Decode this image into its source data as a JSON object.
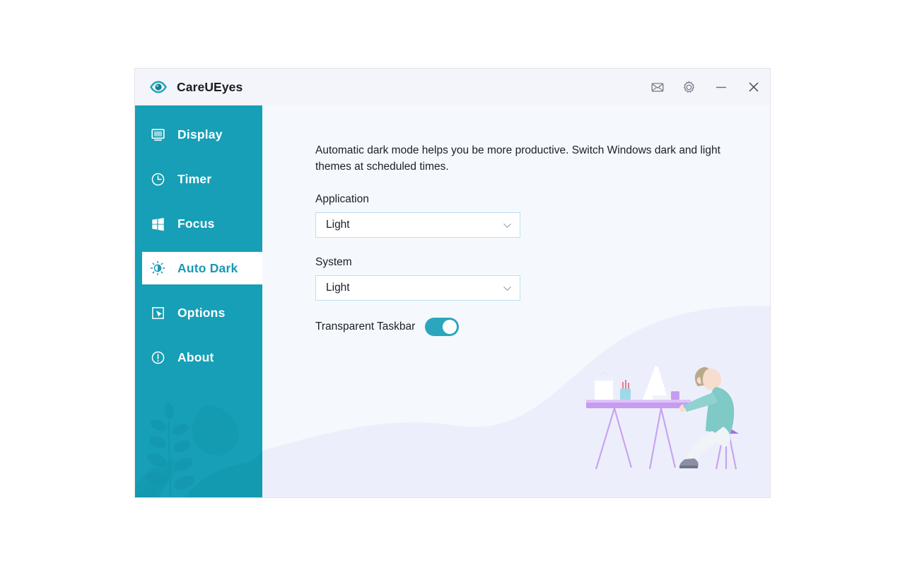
{
  "window": {
    "title": "CareUEyes",
    "logo_icon": "eye-icon",
    "titlebar_buttons": [
      {
        "name": "feedback-mail-button",
        "icon": "mail-envelope-icon",
        "label": ""
      },
      {
        "name": "settings-button",
        "icon": "gear-icon",
        "label": ""
      },
      {
        "name": "minimize-button",
        "icon": "minimize-icon",
        "label": ""
      },
      {
        "name": "close-button",
        "icon": "close-icon",
        "label": ""
      }
    ]
  },
  "sidebar": {
    "background_color": "#169fb6",
    "active_text_color": "#1899b4",
    "items": [
      {
        "id": "display",
        "label": "Display",
        "icon": "monitor-icon",
        "active": false
      },
      {
        "id": "timer",
        "label": "Timer",
        "icon": "clock-icon",
        "active": false
      },
      {
        "id": "focus",
        "label": "Focus",
        "icon": "windows-logo-icon",
        "active": false
      },
      {
        "id": "auto-dark",
        "label": "Auto Dark",
        "icon": "brightness-sun-icon",
        "active": true
      },
      {
        "id": "options",
        "label": "Options",
        "icon": "cursor-square-icon",
        "active": false
      },
      {
        "id": "about",
        "label": "About",
        "icon": "info-circle-icon",
        "active": false
      }
    ]
  },
  "main": {
    "intro": "Automatic dark mode helps you be more productive. Switch Windows dark and light themes at scheduled times.",
    "application": {
      "label": "Application",
      "value": "Light",
      "chevron_icon": "chevron-down-icon"
    },
    "system": {
      "label": "System",
      "value": "Light",
      "chevron_icon": "chevron-down-icon"
    },
    "transparent_taskbar": {
      "label": "Transparent Taskbar",
      "enabled": true,
      "on_color": "#2aa7bd"
    },
    "illustration": "person-at-desk-with-laptop-illustration"
  }
}
